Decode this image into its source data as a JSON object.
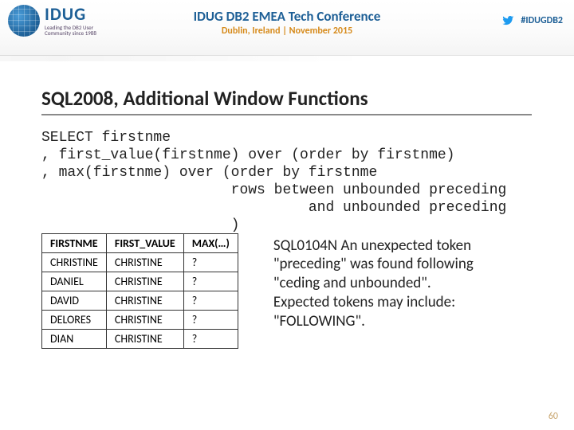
{
  "header": {
    "logo_big": "IDUG",
    "logo_tag": "Leading the DB2 User Community since 1988",
    "conf_title": "IDUG DB2 EMEA Tech Conference",
    "conf_sub": "Dublin, Ireland | November 2015",
    "hashtag": "#IDUGDB2"
  },
  "slide": {
    "title": "SQL2008, Additional Window Functions",
    "code": "SELECT firstnme\n, first_value(firstnme) over (order by firstnme)\n, max(firstnme) over (order by firstnme\n                      rows between unbounded preceding\n                               and unbounded preceding\n                      )",
    "table": {
      "headers": [
        "FIRSTNME",
        "FIRST_VALUE",
        "MAX(…)"
      ],
      "rows": [
        [
          "CHRISTINE",
          "CHRISTINE",
          "?"
        ],
        [
          "DANIEL",
          "CHRISTINE",
          "?"
        ],
        [
          "DAVID",
          "CHRISTINE",
          "?"
        ],
        [
          "DELORES",
          "CHRISTINE",
          "?"
        ],
        [
          "DIAN",
          "CHRISTINE",
          "?"
        ]
      ]
    },
    "error": "SQL0104N  An unexpected token \"preceding\" was found following \"ceding and unbounded\". Expected tokens may include:  \"FOLLOWING\".",
    "page_number": "60"
  }
}
